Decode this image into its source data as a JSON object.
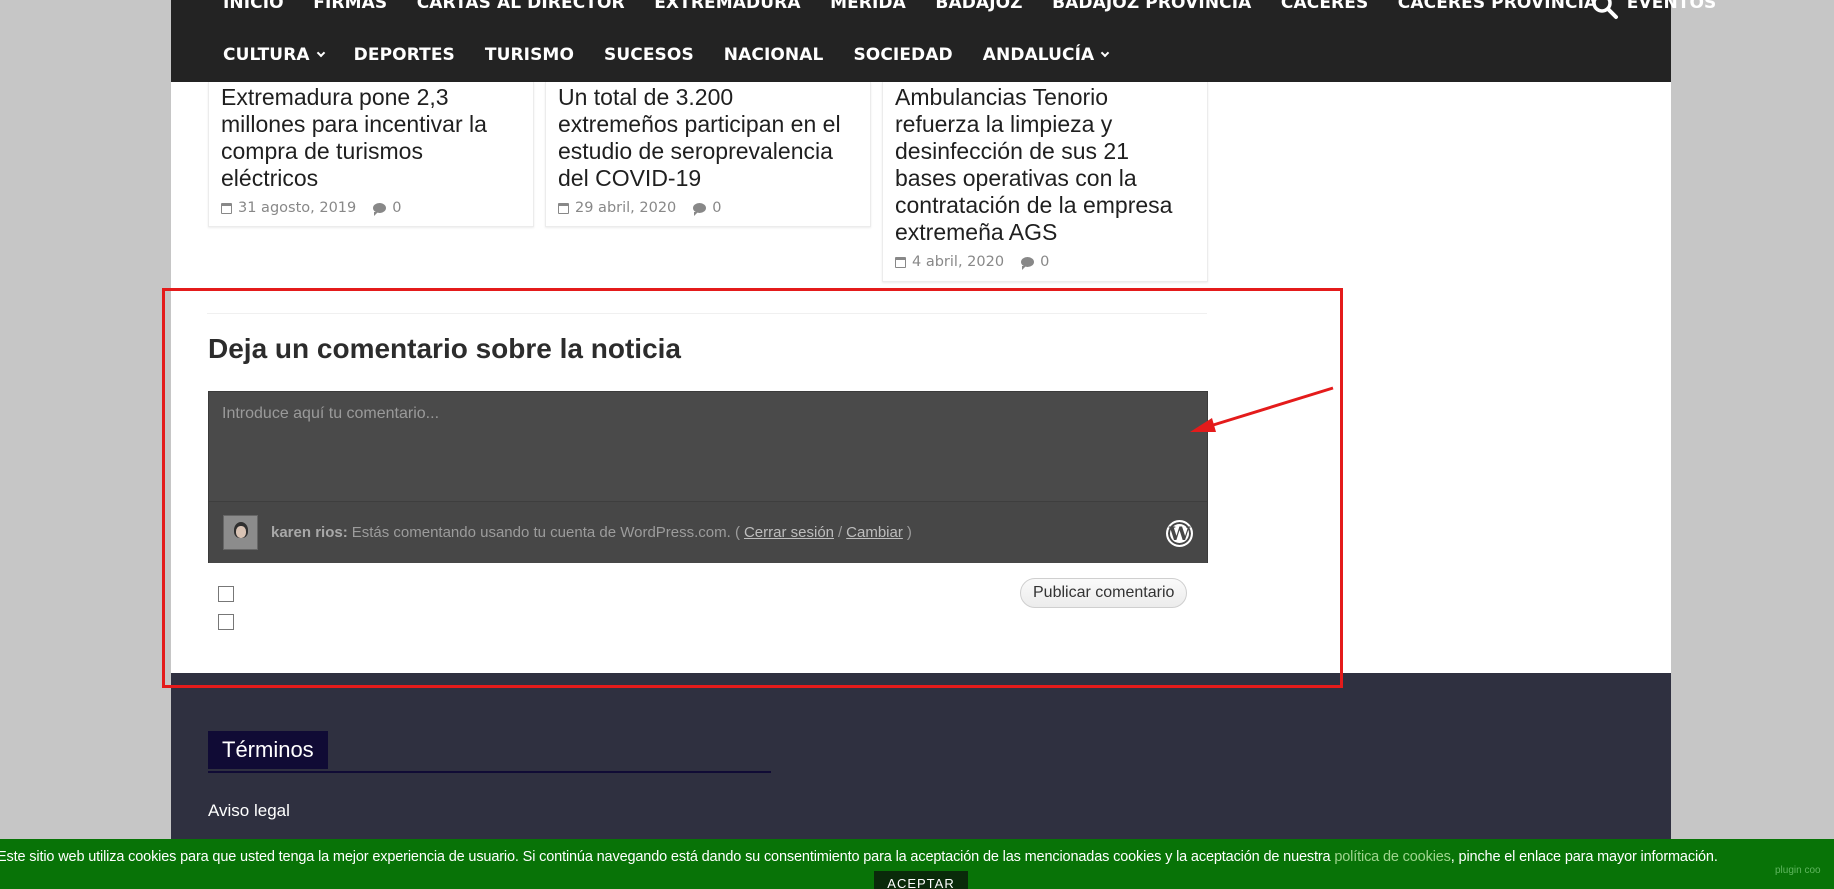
{
  "nav": {
    "row1": [
      "INICIO",
      "FIRMAS",
      "CARTAS AL DIRECTOR",
      "EXTREMADURA",
      "MÉRIDA",
      "BADAJOZ",
      "BADAJOZ PROVINCIA",
      "CÁCERES",
      "CÁCERES PROVINCIA",
      "EVENTOS"
    ],
    "row2": [
      {
        "label": "CULTURA",
        "dropdown": true
      },
      {
        "label": "DEPORTES",
        "dropdown": false
      },
      {
        "label": "TURISMO",
        "dropdown": false
      },
      {
        "label": "SUCESOS",
        "dropdown": false
      },
      {
        "label": "NACIONAL",
        "dropdown": false
      },
      {
        "label": "SOCIEDAD",
        "dropdown": false
      },
      {
        "label": "ANDALUCÍA",
        "dropdown": true
      }
    ],
    "search_icon": "search-icon"
  },
  "related_posts": [
    {
      "title": "Extremadura pone 2,3 millones para incentivar la compra de turismos eléctricos",
      "date": "31 agosto, 2019",
      "comments": "0"
    },
    {
      "title": "Un total de 3.200 extremeños participan en el estudio de seroprevalencia del COVID-19",
      "date": "29 abril, 2020",
      "comments": "0"
    },
    {
      "title": "Ambulancias Tenorio refuerza la limpieza y desinfección de sus 21 bases operativas con la contratación de la empresa extremeña AGS",
      "date": "4 abril, 2020",
      "comments": "0"
    }
  ],
  "comment": {
    "heading": "Deja un comentario sobre la noticia",
    "placeholder": "Introduce aquí tu comentario...",
    "user_name": "karen rios:",
    "identity_text": "Estás comentando usando tu cuenta de WordPress.com. (",
    "logout_link": "Cerrar sesión",
    "separator": "/",
    "change_link": "Cambiar",
    "close_paren": ")",
    "wordpress_icon_letter": "W",
    "publish_label": "Publicar comentario"
  },
  "footer": {
    "terms_title": "Términos",
    "aviso_legal": "Aviso legal"
  },
  "cookie": {
    "text_before": "Este sitio web utiliza cookies para que usted tenga la mejor experiencia de usuario. Si continúa navegando está dando su consentimiento para la aceptación de las mencionadas cookies y la aceptación de nuestra ",
    "link": "política de cookies",
    "text_after": ", pinche el enlace para mayor información.",
    "accept_label": "ACEPTAR",
    "plugin_text": "plugin coo"
  },
  "colors": {
    "nav_bg": "#232323",
    "footer_bg": "#2f3040",
    "terms_bg": "#100b35",
    "cookie_bg": "#087307",
    "annotation": "#e41b1b"
  }
}
